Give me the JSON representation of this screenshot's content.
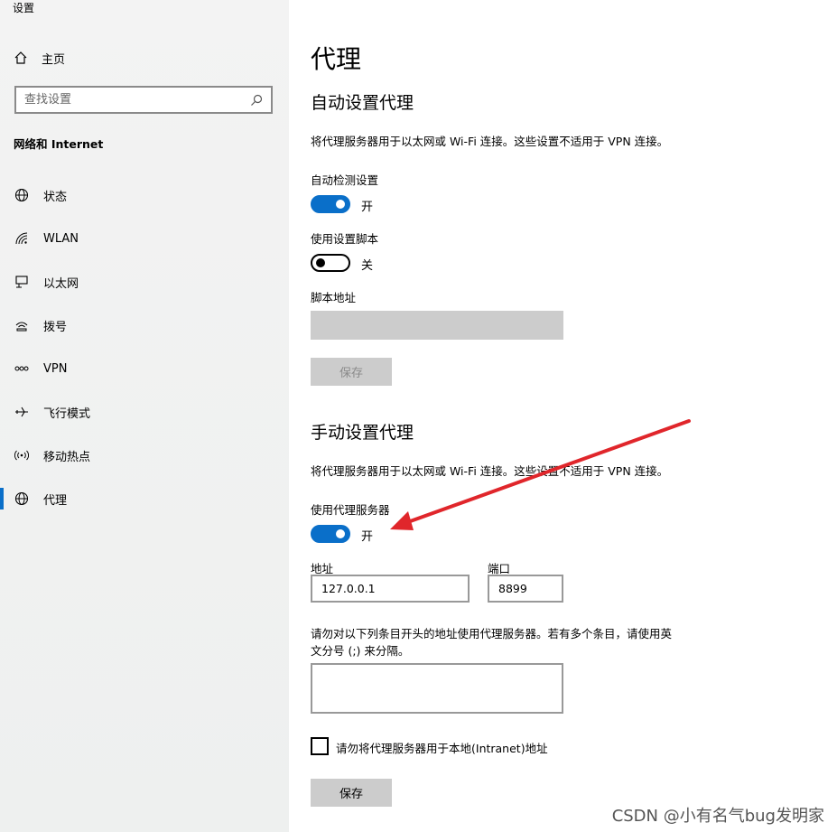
{
  "window": {
    "title": "设置"
  },
  "sidebar": {
    "home_label": "主页",
    "search_placeholder": "查找设置",
    "section_title": "网络和 Internet",
    "items": [
      {
        "label": "状态",
        "icon": "globe-status-icon"
      },
      {
        "label": "WLAN",
        "icon": "wifi-icon"
      },
      {
        "label": "以太网",
        "icon": "ethernet-icon"
      },
      {
        "label": "拨号",
        "icon": "dialup-icon"
      },
      {
        "label": "VPN",
        "icon": "vpn-icon"
      },
      {
        "label": "飞行模式",
        "icon": "airplane-icon"
      },
      {
        "label": "移动热点",
        "icon": "hotspot-icon"
      },
      {
        "label": "代理",
        "icon": "globe-icon",
        "active": true
      }
    ],
    "accent_color": "#0a6fc9"
  },
  "main": {
    "page_title": "代理",
    "auto": {
      "heading": "自动设置代理",
      "description": "将代理服务器用于以太网或 Wi-Fi 连接。这些设置不适用于 VPN 连接。",
      "detect_label": "自动检测设置",
      "detect_state": "开",
      "detect_on": true,
      "script_label": "使用设置脚本",
      "script_state": "关",
      "script_on": false,
      "script_address_label": "脚本地址",
      "script_address_value": "",
      "save_label": "保存"
    },
    "manual": {
      "heading": "手动设置代理",
      "description": "将代理服务器用于以太网或 Wi-Fi 连接。这些设置不适用于 VPN 连接。",
      "use_proxy_label": "使用代理服务器",
      "use_proxy_state": "开",
      "use_proxy_on": true,
      "address_label": "地址",
      "address_value": "127.0.0.1",
      "port_label": "端口",
      "port_value": "8899",
      "exceptions_text_line1": "请勿对以下列条目开头的地址使用代理服务器。若有多个条目，请使用英",
      "exceptions_text_line2": "文分号 (;) 来分隔。",
      "exceptions_value": "",
      "bypass_local_label": "请勿将代理服务器用于本地(Intranet)地址",
      "bypass_local_checked": false,
      "save_label": "保存"
    }
  },
  "watermark": "CSDN @小有名气bug发明家",
  "annotation": {
    "arrow_color": "#e0262b"
  }
}
